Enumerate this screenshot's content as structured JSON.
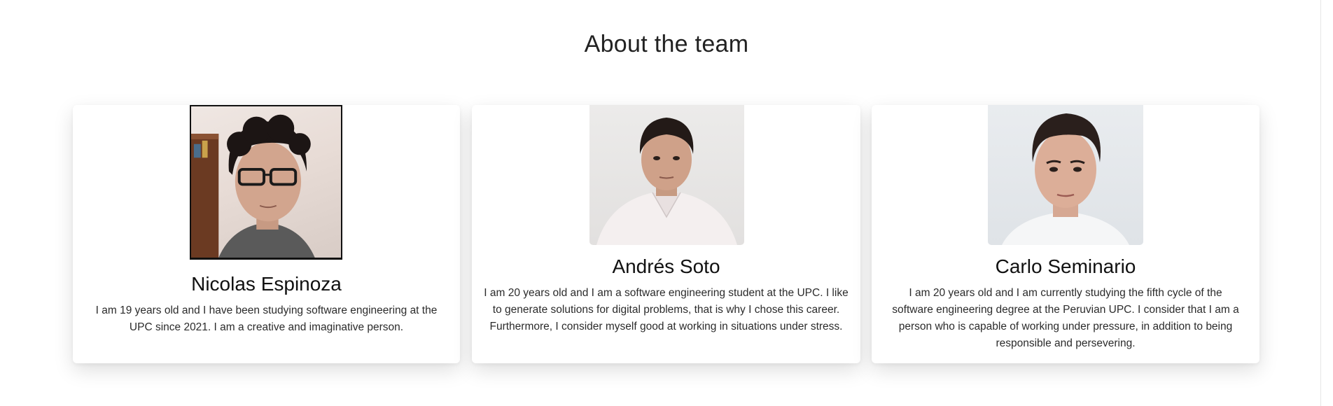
{
  "section": {
    "title": "About the team"
  },
  "team": [
    {
      "name": "Nicolas Espinoza",
      "bio": "I am 19 years old and I have been studying software engineering at the UPC since 2021. I am a creative and imaginative person."
    },
    {
      "name": "Andrés Soto",
      "bio": "I am 20 years old and I am a software engineering student at the UPC. I like to generate solutions for digital problems, that is why I chose this career. Furthermore, I consider myself good at working in situations under stress."
    },
    {
      "name": "Carlo Seminario",
      "bio": "I am 20 years old and I am currently studying the fifth cycle of the software engineering degree at the Peruvian UPC. I consider that I am a person who is capable of working under pressure, in addition to being responsible and persevering."
    }
  ]
}
